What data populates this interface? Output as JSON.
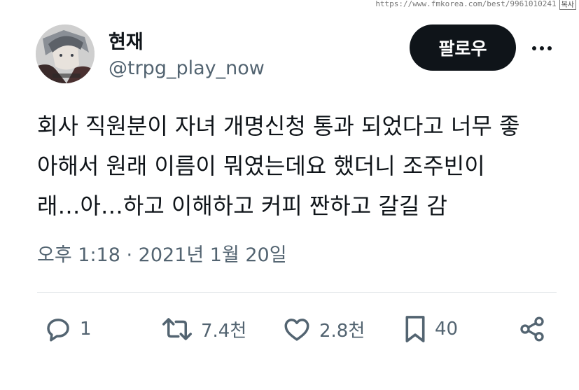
{
  "watermark": {
    "url": "https://www.fmkorea.com/best/9961010241",
    "tag": "복사"
  },
  "author": {
    "display_name": "현재",
    "handle": "@trpg_play_now",
    "avatar": "anime-character-avatar"
  },
  "follow_label": "팔로우",
  "more_icon": "more-dots-icon",
  "tweet": {
    "lines": [
      "회사 직원분이 자녀 개명신청 통과 되었다고 너무 좋",
      "아해서 원래 이름이 뭐였는데요 했더니 조주빈이",
      "래…아…하고 이해하고 커피 짠하고 갈길 감"
    ],
    "timestamp": "오후 1:18 · 2021년 1월 20일"
  },
  "actions": {
    "reply": {
      "icon": "reply-icon",
      "count": "1"
    },
    "retweet": {
      "icon": "retweet-icon",
      "count": "7.4천"
    },
    "like": {
      "icon": "heart-icon",
      "count": "2.8천"
    },
    "bookmark": {
      "icon": "bookmark-icon",
      "count": "40"
    },
    "share": {
      "icon": "share-icon"
    }
  },
  "colors": {
    "text": "#0f1419",
    "secondary": "#536471",
    "button_bg": "#0f1419",
    "divider": "#e3e7ea"
  }
}
